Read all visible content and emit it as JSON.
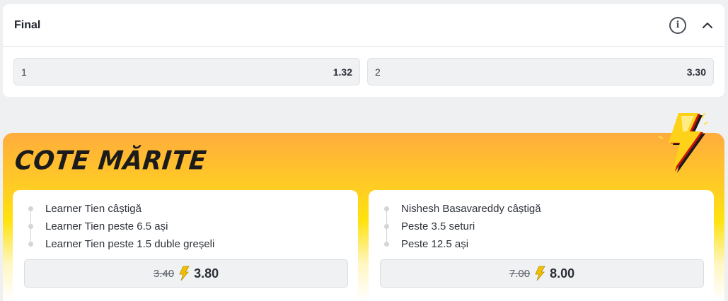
{
  "market": {
    "title": "Final",
    "info_icon": "info-icon",
    "collapse_icon": "chevron-up-icon",
    "outcomes": [
      {
        "label": "1",
        "odds": "1.32"
      },
      {
        "label": "2",
        "odds": "3.30"
      }
    ]
  },
  "boost": {
    "title": "COTE MĂRITE",
    "colors": {
      "top": "#ffac3d",
      "middle": "#ffe20e",
      "bolt": "#f2c200"
    },
    "offers": [
      {
        "selections": [
          "Learner Tien câștigă",
          "Learner Tien peste 6.5 ași",
          "Learner Tien peste 1.5 duble greșeli"
        ],
        "old_odds": "3.40",
        "new_odds": "3.80"
      },
      {
        "selections": [
          "Nishesh Basavareddy câștigă",
          "Peste 3.5 seturi",
          "Peste 12.5 ași"
        ],
        "old_odds": "7.00",
        "new_odds": "8.00"
      }
    ]
  }
}
